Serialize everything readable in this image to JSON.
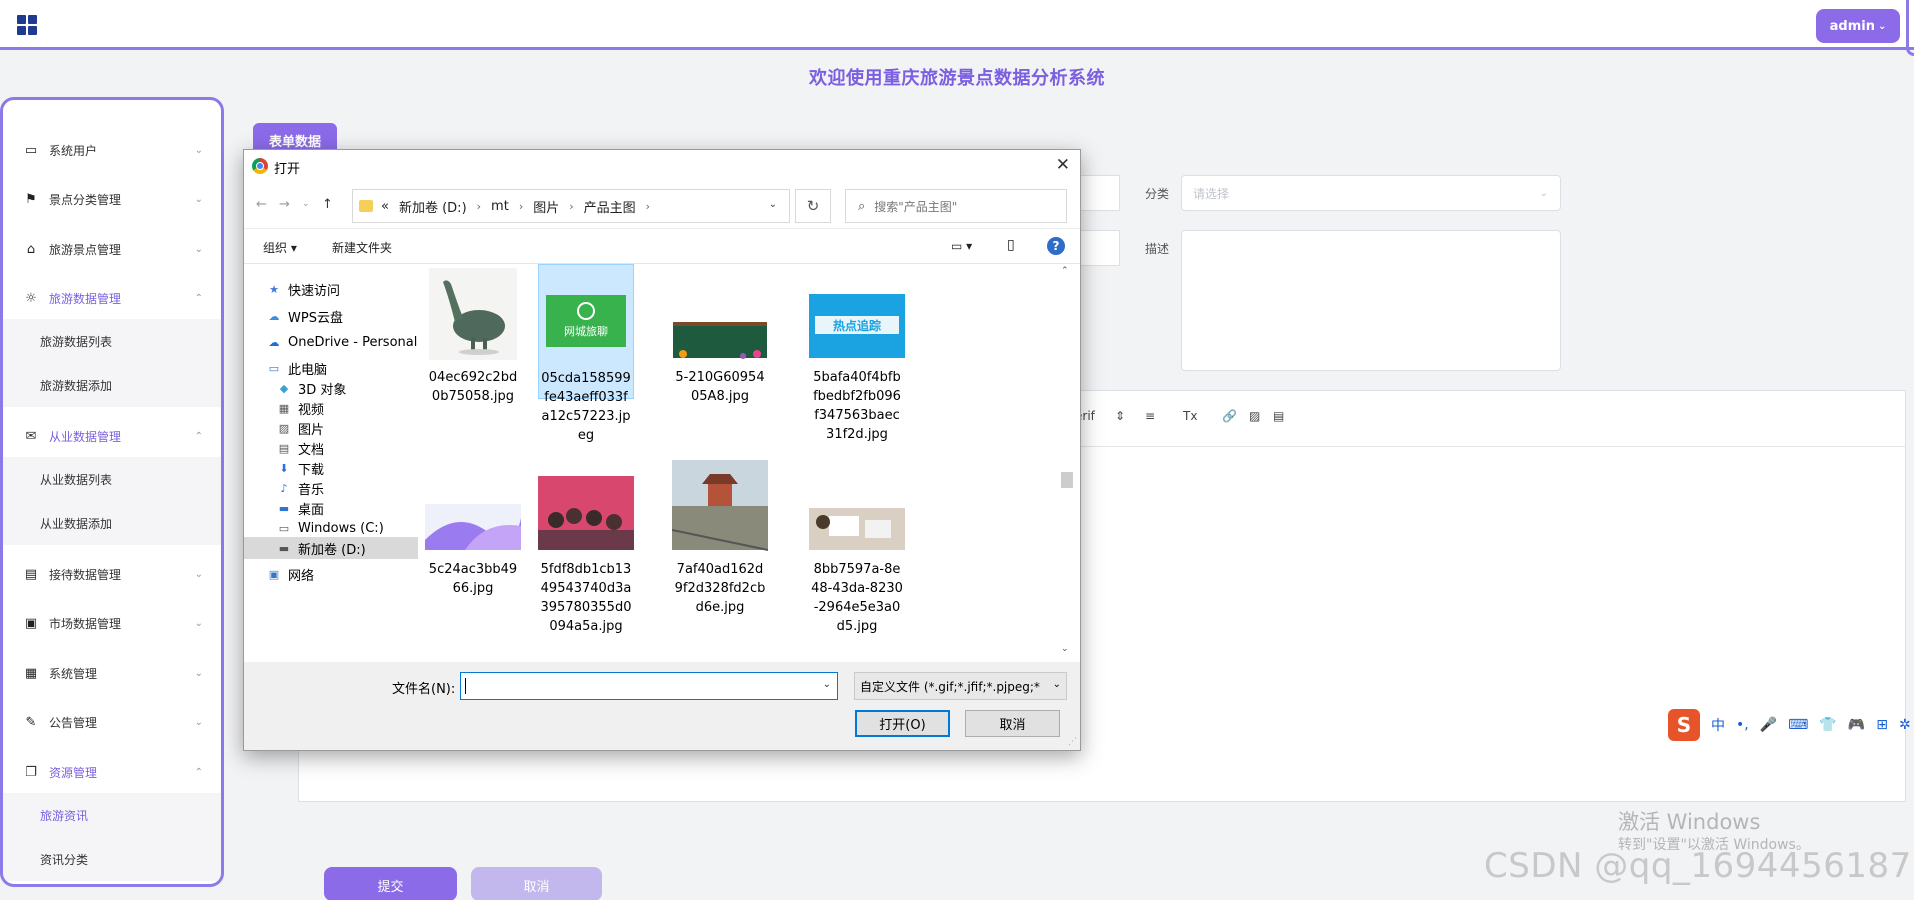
{
  "topbar": {
    "admin_label": "admin",
    "admin_chev": "⌄"
  },
  "page_title": "欢迎使用重庆旅游景点数据分析系统",
  "sidebar": {
    "cut_label": "   ",
    "items": [
      {
        "label": "系统用户",
        "icon": "laptop-icon",
        "glyph": "▭",
        "arrow": "⌄"
      },
      {
        "label": "景点分类管理",
        "icon": "bookmark-icon",
        "glyph": "⚑",
        "arrow": "⌄"
      },
      {
        "label": "旅游景点管理",
        "icon": "tag-icon",
        "glyph": "⌂",
        "arrow": "⌄"
      },
      {
        "label": "旅游数据管理",
        "icon": "sun-icon",
        "glyph": "☼",
        "arrow": "⌃"
      },
      {
        "label": "从业数据管理",
        "icon": "mail-icon",
        "glyph": "✉",
        "arrow": "⌃"
      },
      {
        "label": "接待数据管理",
        "icon": "clipboard-icon",
        "glyph": "▤",
        "arrow": "⌄"
      },
      {
        "label": "市场数据管理",
        "icon": "chat-icon",
        "glyph": "▣",
        "arrow": "⌄"
      },
      {
        "label": "系统管理",
        "icon": "archive-icon",
        "glyph": "▦",
        "arrow": "⌄"
      },
      {
        "label": "公告管理",
        "icon": "paperclip-icon",
        "glyph": "✎",
        "arrow": "⌄"
      },
      {
        "label": "资源管理",
        "icon": "copy-icon",
        "glyph": "❐",
        "arrow": "⌃"
      }
    ],
    "subitems": [
      {
        "label": "旅游数据列表"
      },
      {
        "label": "旅游数据添加"
      },
      {
        "label": "从业数据列表"
      },
      {
        "label": "从业数据添加"
      },
      {
        "label": "旅游资讯"
      },
      {
        "label": "资讯分类"
      }
    ]
  },
  "main": {
    "tag_label": "表单数据",
    "category_label": "分类",
    "category_placeholder": "请选择",
    "desc_label": "描述",
    "editor_toolbar": [
      "erif",
      "⇕",
      "≡",
      "Tx",
      "🔗",
      "▨",
      "▤"
    ],
    "submit_label": "提交",
    "cancel_label": "取消"
  },
  "overlay": {
    "activate_title": "激活 Windows",
    "activate_sub": "转到\"设置\"以激活 Windows。",
    "csdn": "CSDN @qq_1694456187",
    "ime_logo": "S",
    "ime_items": [
      "中",
      "•,",
      "🎤",
      "⌨",
      "👕",
      "🎮",
      "⊞",
      "✲"
    ]
  },
  "dialog": {
    "title": "打开",
    "close": "✕",
    "nav": {
      "back": "←",
      "forward": "→",
      "dropdown": "⌄",
      "up": "↑"
    },
    "breadcrumb_prefix": "«",
    "breadcrumbs": [
      "新加卷 (D:)",
      "mt",
      "图片",
      "产品主图"
    ],
    "refresh": "↻",
    "search_placeholder": "搜索\"产品主图\"",
    "toolbar": {
      "organize": "组织 ▾",
      "new_folder": "新建文件夹",
      "view": "▭ ▾",
      "pane": "▯",
      "help": "?"
    },
    "nav_tree": [
      {
        "label": "快速访问",
        "icon": "star-icon",
        "glyph": "★",
        "color": "#3d7bd6"
      },
      {
        "label": "WPS云盘",
        "icon": "cloud-icon",
        "glyph": "☁",
        "color": "#3b8de0"
      },
      {
        "label": "OneDrive - Personal",
        "icon": "onedrive-icon",
        "glyph": "☁",
        "color": "#1e6fd9"
      },
      {
        "label": "此电脑",
        "icon": "pc-icon",
        "glyph": "▭",
        "color": "#3a74c4"
      },
      {
        "label": "3D 对象",
        "icon": "cube-icon",
        "glyph": "◆",
        "color": "#3aa0d8"
      },
      {
        "label": "视频",
        "icon": "video-icon",
        "glyph": "▦",
        "color": "#555"
      },
      {
        "label": "图片",
        "icon": "picture-icon",
        "glyph": "▨",
        "color": "#555"
      },
      {
        "label": "文档",
        "icon": "document-icon",
        "glyph": "▤",
        "color": "#555"
      },
      {
        "label": "下载",
        "icon": "download-icon",
        "glyph": "⬇",
        "color": "#2f72d2"
      },
      {
        "label": "音乐",
        "icon": "music-icon",
        "glyph": "♪",
        "color": "#2f72d2"
      },
      {
        "label": "桌面",
        "icon": "desktop-icon",
        "glyph": "▬",
        "color": "#2f72d2"
      },
      {
        "label": "Windows (C:)",
        "icon": "drive-c-icon",
        "glyph": "▭",
        "color": "#555"
      },
      {
        "label": "新加卷 (D:)",
        "icon": "drive-d-icon",
        "glyph": "▬",
        "color": "#555"
      },
      {
        "label": "网络",
        "icon": "network-icon",
        "glyph": "▣",
        "color": "#3a74c4"
      }
    ],
    "files": [
      {
        "name": "04ec692c2bd0b75058.jpg",
        "thumb": "bird-thumbnail"
      },
      {
        "name": "05cda158599fe43aeff033fa12c57223.jpeg",
        "thumb": "green-banner-thumbnail"
      },
      {
        "name": "5-210G6095405A8.jpg",
        "thumb": "blackboard-thumbnail"
      },
      {
        "name": "5bafa40f4bfbfbedbf2fb096f347563baec31f2d.jpg",
        "thumb": "hot-topic-thumbnail"
      },
      {
        "name": "5c24ac3bb4966.jpg",
        "thumb": "purple-wave-thumbnail"
      },
      {
        "name": "5fdf8db1cb1349543740d3a395780355d0094a5a.jpg",
        "thumb": "group-photo-thumbnail"
      },
      {
        "name": "7af40ad162d9f2d328fd2cbd6e.jpg",
        "thumb": "pagoda-thumbnail"
      },
      {
        "name": "8bb7597a-8e48-43da-8230-2964e5e3a0d5.jpg",
        "thumb": "workshop-thumbnail"
      }
    ],
    "thumb_text": {
      "green": "网城旅聊",
      "hot": "热点追踪"
    },
    "filename_label": "文件名(N):",
    "filename_value": "",
    "filetype": "自定义文件 (*.gif;*.jfif;*.pjpeg;*",
    "open_label": "打开(O)",
    "cancel_label": "取消",
    "scroll_up": "⌃",
    "scroll_down": "⌄"
  }
}
